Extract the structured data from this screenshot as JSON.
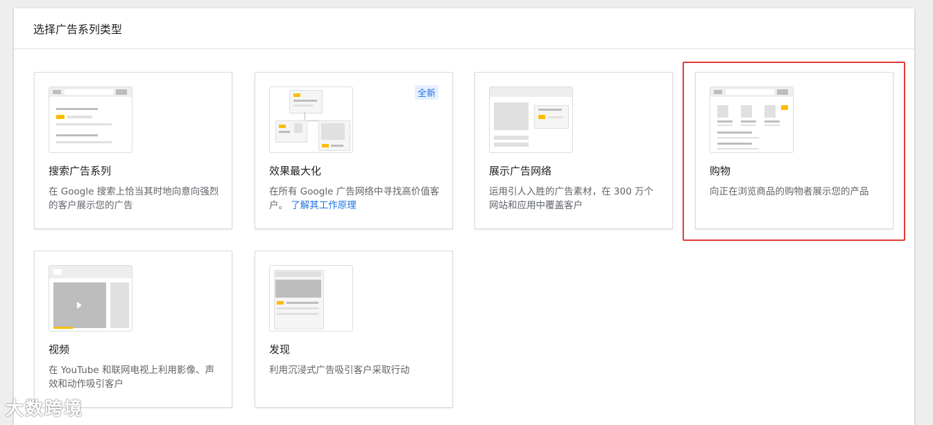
{
  "header": {
    "title": "选择广告系列类型"
  },
  "cards": [
    {
      "title": "搜索广告系列",
      "description": "在 Google 搜索上恰当其时地向意向强烈的客户展示您的广告"
    },
    {
      "title": "效果最大化",
      "badge": "全新",
      "description": "在所有 Google 广告网络中寻找高价值客户。",
      "link": "了解其工作原理"
    },
    {
      "title": "展示广告网络",
      "description": "运用引人入胜的广告素材，在 300 万个网站和应用中覆盖客户"
    },
    {
      "title": "购物",
      "description": "向正在浏览商品的购物者展示您的产品",
      "selected": true
    },
    {
      "title": "视频",
      "description": "在 YouTube 和联网电视上利用影像、声效和动作吸引客户"
    },
    {
      "title": "发现",
      "description": "利用沉浸式广告吸引客户采取行动"
    }
  ],
  "watermark": "大数跨境",
  "colors": {
    "accent": "#fbbc04",
    "link": "#1a73e8",
    "selection": "#e53935"
  }
}
